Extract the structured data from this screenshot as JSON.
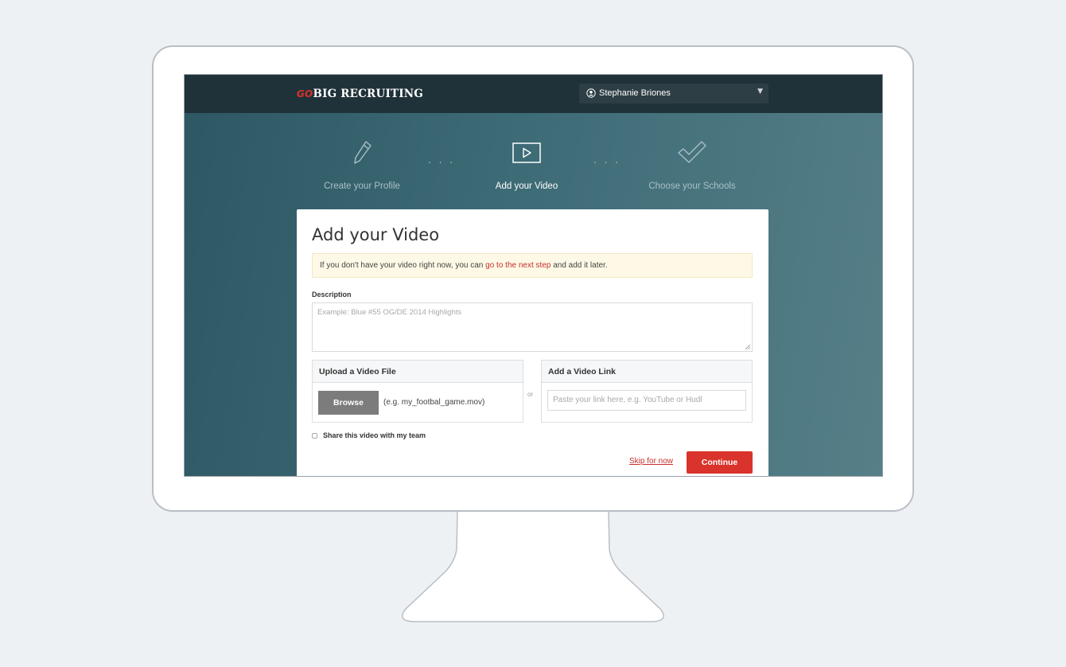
{
  "navbar": {
    "logo_prefix": "GO",
    "logo_text": "BIG RECRUITING",
    "user_name": "Stephanie Briones"
  },
  "steps": [
    {
      "label": "Create your Profile",
      "icon": "pencil-icon",
      "active": false
    },
    {
      "label": "Add your Video",
      "icon": "play-icon",
      "active": true
    },
    {
      "label": "Choose your Schools",
      "icon": "checkmark-icon",
      "active": false
    }
  ],
  "step_separator": ". . .",
  "card": {
    "title": "Add your Video",
    "notice_before": "If you don't have your video right now, you can ",
    "notice_link": "go to the next step",
    "notice_after": " and add it later.",
    "description_label": "Description",
    "description_placeholder": "Example: Blue #55 OG/DE 2014 Highlights",
    "upload_title": "Upload a Video File",
    "browse_label": "Browse",
    "upload_example": "(e.g. my_footbal_game.mov)",
    "or_label": "or",
    "link_title": "Add a Video Link",
    "link_placeholder": "Paste your link here, e.g. YouTube or Hudl",
    "share_label": "Share this video with my team",
    "skip_label": "Skip for now",
    "continue_label": "Continue"
  },
  "colors": {
    "accent": "#d9332b",
    "navbar": "#1f3239",
    "background_teal": "#3d6b76"
  }
}
